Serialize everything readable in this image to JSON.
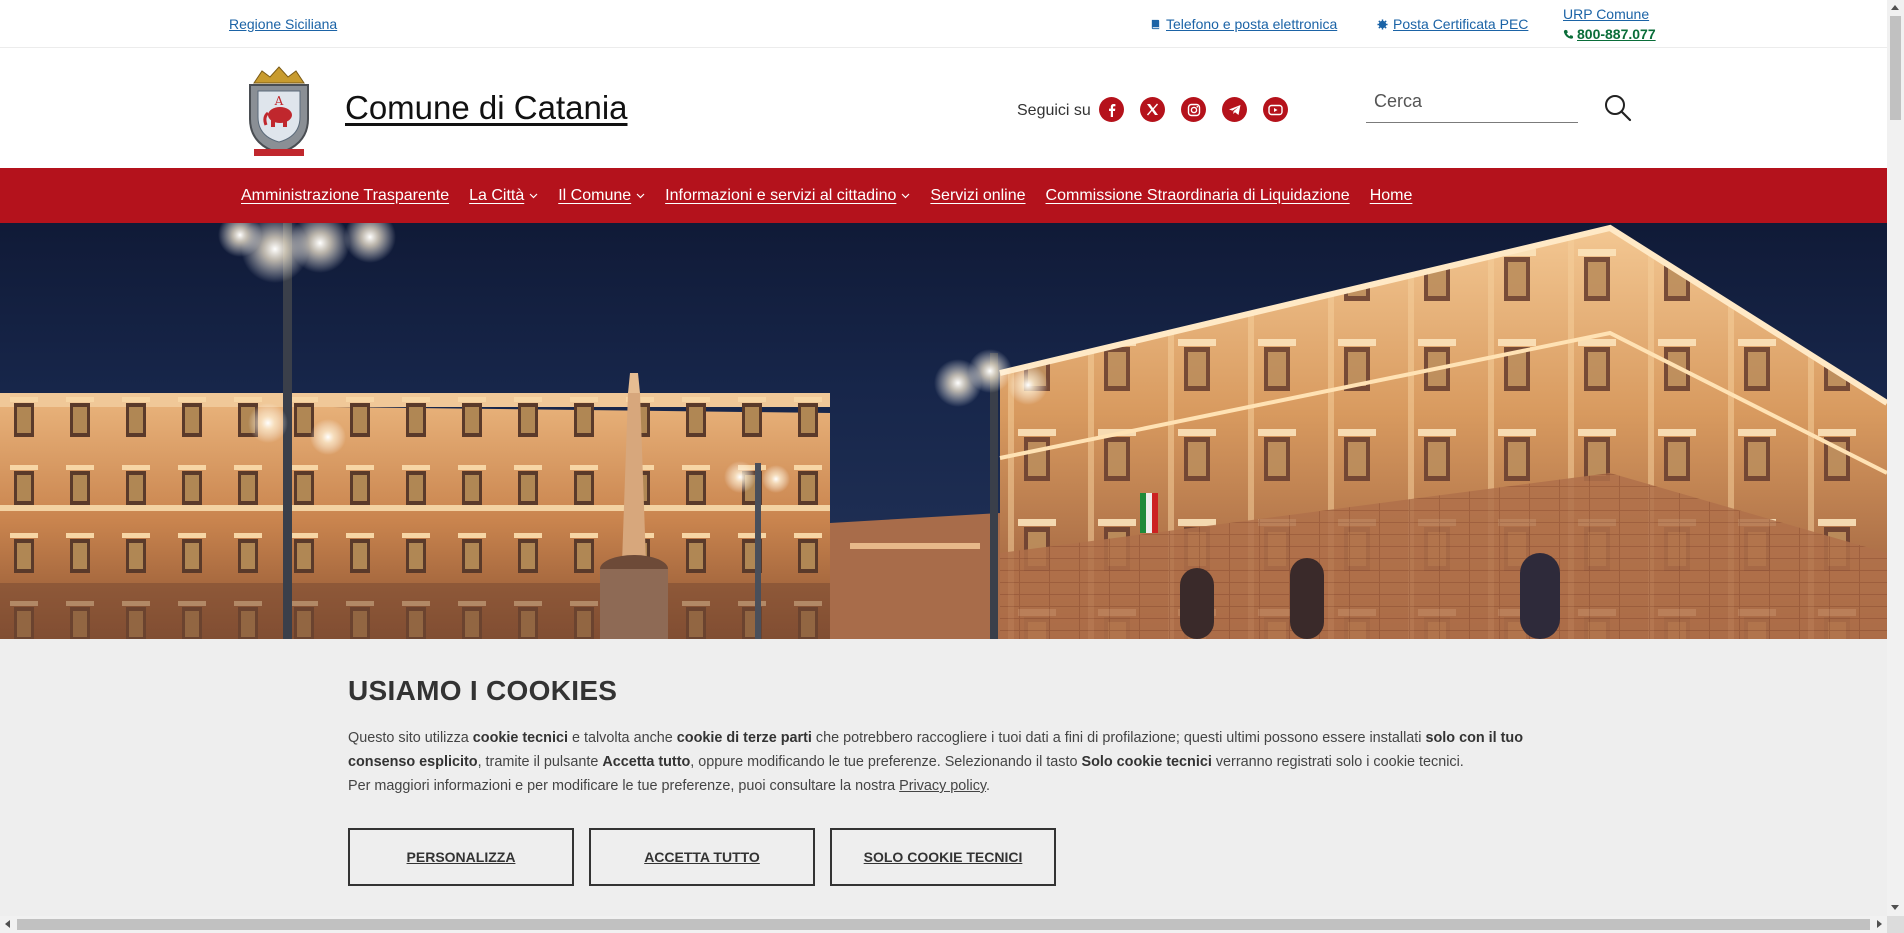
{
  "topbar": {
    "region_link": "Regione Siciliana",
    "tel_link": "Telefono e posta elettronica",
    "pec_link": "Posta Certificata PEC",
    "urp_link": "URP Comune",
    "phone": "800-887.077"
  },
  "header": {
    "title": "Comune di Catania",
    "follow_label": "Seguici su",
    "socials": [
      "facebook-icon",
      "x-twitter-icon",
      "instagram-icon",
      "telegram-icon",
      "youtube-icon"
    ],
    "search_placeholder": "Cerca"
  },
  "nav": {
    "items": [
      {
        "label": "Amministrazione Trasparente",
        "dropdown": false
      },
      {
        "label": "La Città",
        "dropdown": true
      },
      {
        "label": "Il Comune",
        "dropdown": true
      },
      {
        "label": "Informazioni e servizi al cittadino",
        "dropdown": true
      },
      {
        "label": "Servizi online",
        "dropdown": false
      },
      {
        "label": "Commissione Straordinaria di Liquidazione",
        "dropdown": false
      },
      {
        "label": "Home",
        "dropdown": false
      }
    ]
  },
  "cookie": {
    "title": "USIAMO I COOKIES",
    "p1_a": "Questo sito utilizza ",
    "p1_b": "cookie tecnici",
    "p1_c": " e talvolta anche ",
    "p1_d": "cookie di terze parti",
    "p1_e": " che potrebbero raccogliere i tuoi dati a fini di profilazione; questi ultimi possono essere installati ",
    "p1_f": "solo con il tuo consenso esplicito",
    "p1_g": ", tramite il pulsante ",
    "p1_h": "Accetta tutto",
    "p1_i": ", oppure modificando le tue preferenze. Selezionando il tasto ",
    "p1_j": "Solo cookie tecnici",
    "p1_k": " verranno registrati solo i cookie tecnici.",
    "p2_a": "Per maggiori informazioni e per modificare le tue preferenze, puoi consultare la nostra ",
    "p2_link": "Privacy policy",
    "p2_b": ".",
    "btn_customize": "PERSONALIZZA",
    "btn_accept": "ACCETTA TUTTO",
    "btn_technical": "SOLO COOKIE TECNICI"
  },
  "colors": {
    "brand_red": "#b4121c",
    "link_blue": "#1b63a6",
    "phone_green": "#0a6d39"
  }
}
